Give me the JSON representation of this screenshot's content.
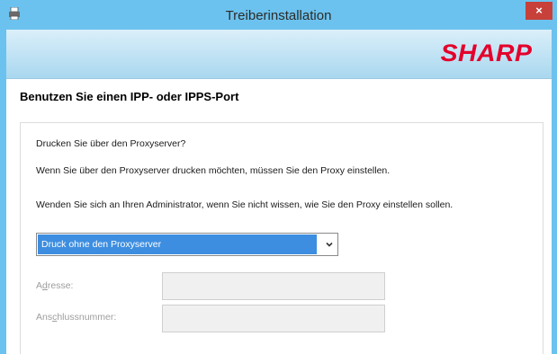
{
  "window": {
    "title": "Treiberinstallation",
    "close_label": "×"
  },
  "banner": {
    "brand": "SHARP",
    "brand_color": "#e4002b"
  },
  "content": {
    "heading": "Benutzen Sie einen IPP- oder IPPS-Port",
    "question": "Drucken Sie über den Proxyserver?",
    "info1": "Wenn Sie über den Proxyserver drucken möchten, müssen Sie den Proxy einstellen.",
    "info2": "Wenden Sie sich an Ihren Administrator, wenn Sie nicht wissen, wie Sie den Proxy einstellen sollen.",
    "proxy_select": {
      "selected": "Druck ohne den Proxyserver"
    },
    "address": {
      "label_pre": "A",
      "label_ul": "d",
      "label_post": "resse:",
      "value": ""
    },
    "port": {
      "label_pre": "Ans",
      "label_ul": "c",
      "label_post": "hlussnummer:",
      "value": ""
    }
  },
  "colors": {
    "titlebar": "#6cc2ee",
    "close_button": "#c7403a",
    "selection": "#3d8ee0"
  }
}
